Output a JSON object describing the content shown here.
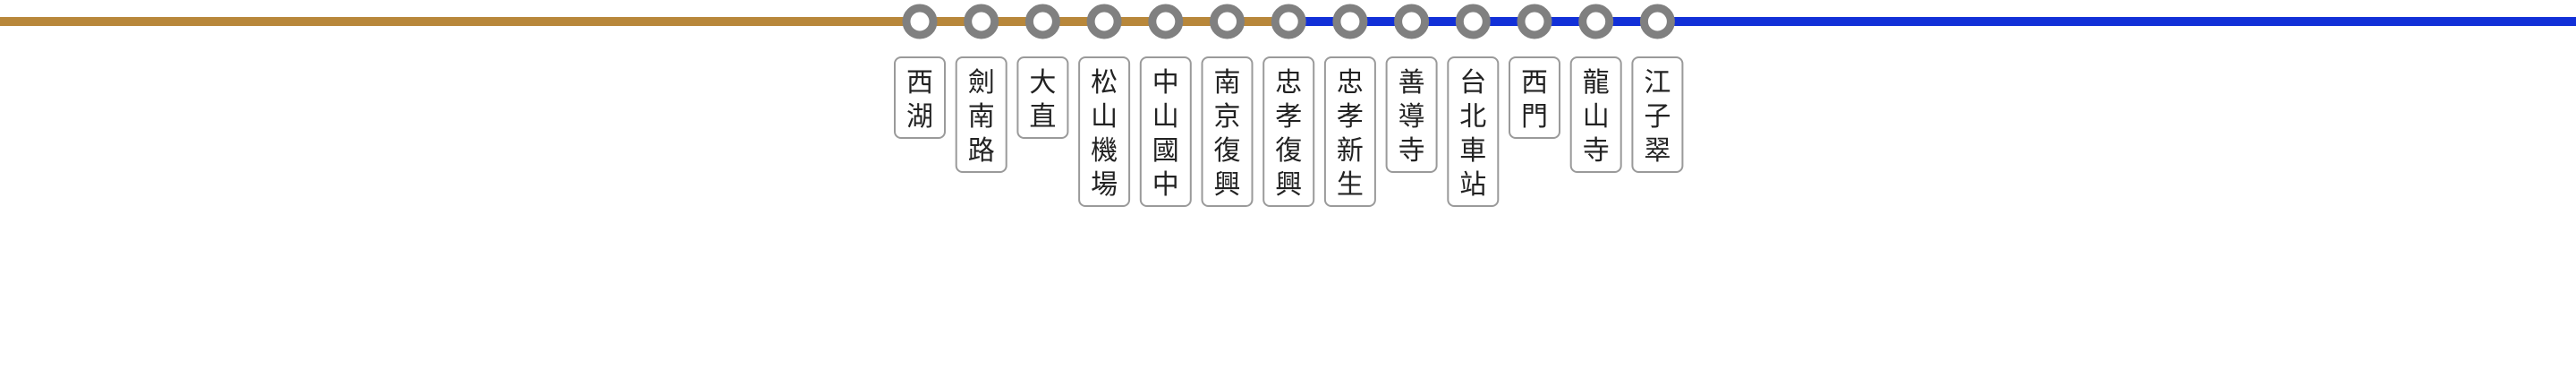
{
  "lines": {
    "west_color": "#b8873a",
    "east_color": "#1230d8",
    "marker_stroke": "#808080",
    "marker_fill": "#ffffff",
    "label_border": "#9a9a9a"
  },
  "stations": [
    {
      "name": "西湖"
    },
    {
      "name": "劍南路"
    },
    {
      "name": "大直"
    },
    {
      "name": "松山機場"
    },
    {
      "name": "中山國中"
    },
    {
      "name": "南京復興"
    },
    {
      "name": "忠孝復興"
    },
    {
      "name": "忠孝新生"
    },
    {
      "name": "善導寺"
    },
    {
      "name": "台北車站"
    },
    {
      "name": "西門"
    },
    {
      "name": "龍山寺"
    },
    {
      "name": "江子翠"
    }
  ]
}
